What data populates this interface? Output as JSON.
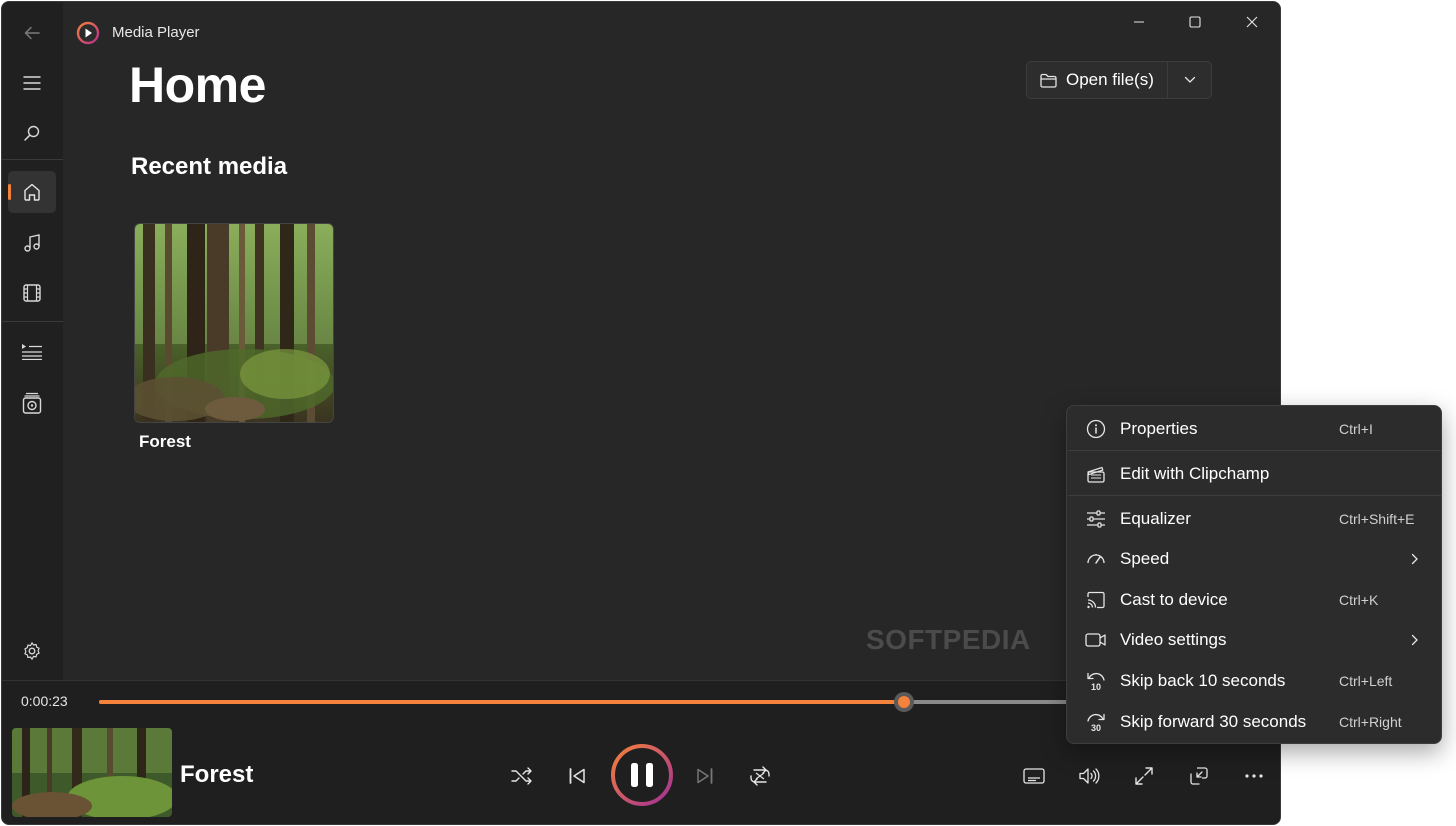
{
  "app": {
    "title": "Media Player"
  },
  "window_controls": {
    "minimize": "minimize-icon",
    "maximize": "maximize-icon",
    "close": "close-icon"
  },
  "sidebar": {
    "items": [
      {
        "name": "back",
        "icon": "back-arrow-icon"
      },
      {
        "name": "menu",
        "icon": "hamburger-icon"
      },
      {
        "name": "search",
        "icon": "search-icon"
      },
      {
        "name": "home",
        "icon": "home-icon",
        "active": true
      },
      {
        "name": "music",
        "icon": "music-note-icon"
      },
      {
        "name": "video",
        "icon": "film-icon"
      },
      {
        "name": "play-queue",
        "icon": "queue-icon"
      },
      {
        "name": "playlists",
        "icon": "playlist-icon"
      },
      {
        "name": "settings",
        "icon": "gear-icon"
      }
    ],
    "accent": "#f5823a"
  },
  "main": {
    "page_title": "Home",
    "open_button": {
      "label": "Open file(s)",
      "icon": "folder-icon"
    },
    "recent_section_title": "Recent media",
    "recent_items": [
      {
        "title": "Forest"
      }
    ]
  },
  "watermark": "SOFTPEDIA",
  "player": {
    "elapsed": "0:00:23",
    "progress": 0.688,
    "now_playing": "Forest",
    "controls": [
      "shuffle-icon",
      "previous-icon",
      "pause-icon",
      "next-icon",
      "repeat-icon"
    ],
    "right_controls": [
      "subtitles-icon",
      "volume-icon",
      "fullscreen-icon",
      "mini-player-icon",
      "more-icon"
    ]
  },
  "context_menu": {
    "items": [
      {
        "label": "Properties",
        "shortcut": "Ctrl+I",
        "icon": "info-icon"
      },
      {
        "label": "Edit with Clipchamp",
        "shortcut": "",
        "icon": "clapperboard-icon"
      },
      {
        "label": "Equalizer",
        "shortcut": "Ctrl+Shift+E",
        "icon": "equalizer-icon"
      },
      {
        "label": "Speed",
        "shortcut": "",
        "icon": "speed-icon",
        "submenu": true
      },
      {
        "label": "Cast to device",
        "shortcut": "Ctrl+K",
        "icon": "cast-icon"
      },
      {
        "label": "Video settings",
        "shortcut": "",
        "icon": "video-camera-icon",
        "submenu": true
      },
      {
        "label": "Skip back 10 seconds",
        "shortcut": "Ctrl+Left",
        "icon": "skip-back-10-icon"
      },
      {
        "label": "Skip forward 30 seconds",
        "shortcut": "Ctrl+Right",
        "icon": "skip-forward-30-icon"
      }
    ],
    "skip_back_glyph": "10",
    "skip_forward_glyph": "30"
  }
}
